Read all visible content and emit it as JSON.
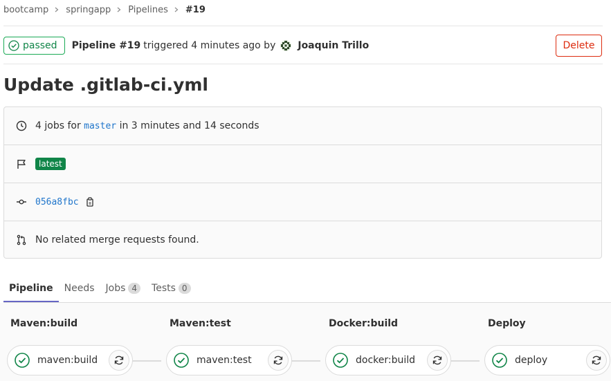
{
  "breadcrumb": [
    "bootcamp",
    "springapp",
    "Pipelines",
    "#19"
  ],
  "header": {
    "status": "passed",
    "pipeline_label": "Pipeline #19",
    "triggered_text": "triggered 4 minutes ago by",
    "user_name": "Joaquin Trillo",
    "delete_label": "Delete"
  },
  "title": "Update .gitlab-ci.yml",
  "info": {
    "jobs_prefix": "4 jobs for",
    "branch": "master",
    "jobs_suffix": "in 3 minutes and 14 seconds",
    "badge": "latest",
    "commit_sha": "056a8fbc",
    "merge_requests": "No related merge requests found."
  },
  "tabs": [
    {
      "label": "Pipeline",
      "count": null,
      "active": true
    },
    {
      "label": "Needs",
      "count": null,
      "active": false
    },
    {
      "label": "Jobs",
      "count": "4",
      "active": false
    },
    {
      "label": "Tests",
      "count": "0",
      "active": false
    }
  ],
  "stages": [
    {
      "name": "Maven:build",
      "job": "maven:build"
    },
    {
      "name": "Maven:test",
      "job": "maven:test"
    },
    {
      "name": "Docker:build",
      "job": "docker:build"
    },
    {
      "name": "Deploy",
      "job": "deploy"
    }
  ],
  "colors": {
    "success": "#108548",
    "danger": "#dd2b0e",
    "link": "#1f75cb",
    "tab_active": "#6666c4"
  }
}
